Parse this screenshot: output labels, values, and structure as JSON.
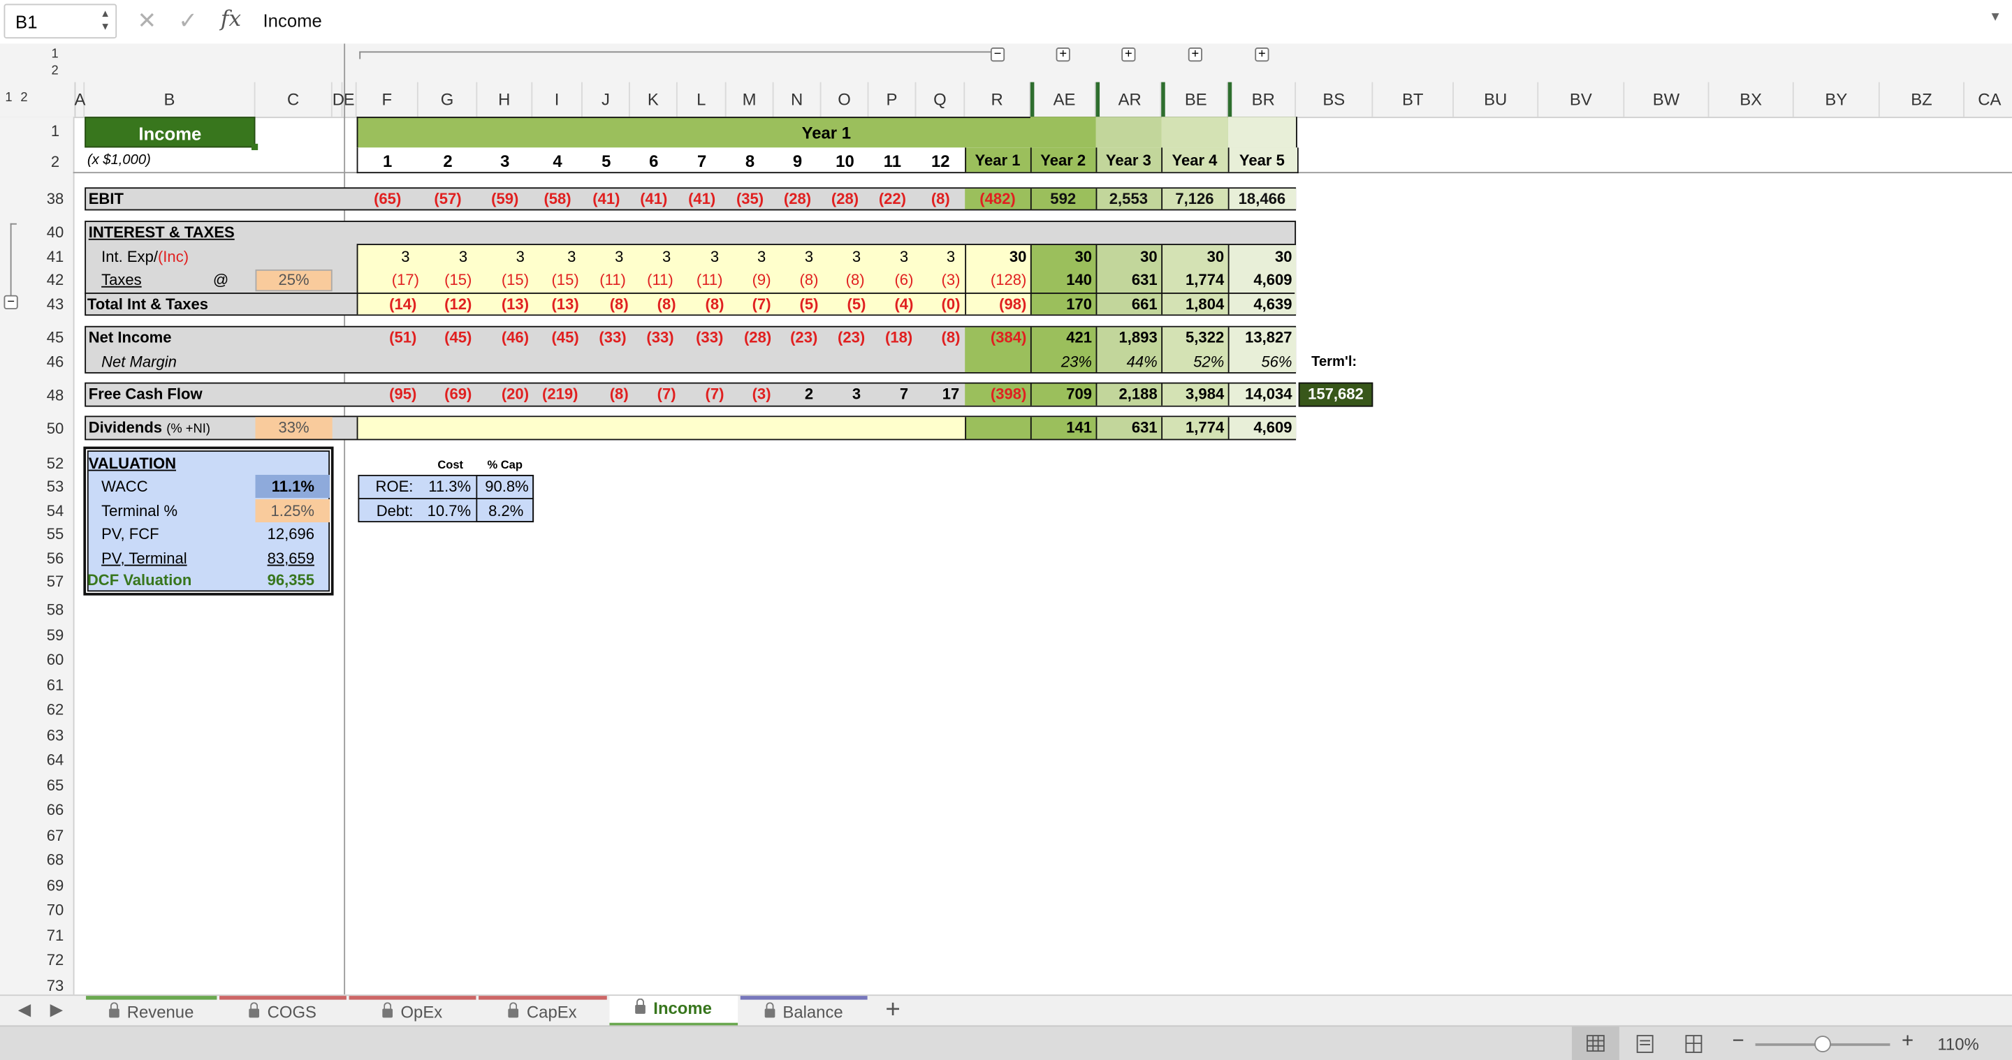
{
  "formula_bar": {
    "name_box": "B1",
    "cancel_icon": "✕",
    "enter_icon": "✓",
    "fx_label": "fx",
    "value": "Income"
  },
  "outline": {
    "row_levels": [
      "1",
      "2"
    ],
    "col_levels": [
      "1",
      "2"
    ]
  },
  "columns": [
    "A",
    "B",
    "C",
    "D",
    "E",
    "F",
    "G",
    "H",
    "I",
    "J",
    "K",
    "L",
    "M",
    "N",
    "O",
    "P",
    "Q",
    "R",
    "AE",
    "AR",
    "BE",
    "BR",
    "BS",
    "BT",
    "BU",
    "BV",
    "BW",
    "BX",
    "BY",
    "BZ",
    "CA"
  ],
  "rows": [
    "1",
    "2",
    "38",
    "40",
    "41",
    "42",
    "43",
    "45",
    "46",
    "48",
    "50",
    "52",
    "53",
    "54",
    "55",
    "56",
    "57",
    "58",
    "59",
    "60",
    "61",
    "62",
    "63",
    "64",
    "65",
    "66",
    "67",
    "68",
    "69",
    "70",
    "71",
    "72",
    "73"
  ],
  "sheet": {
    "title": "Income",
    "subtitle": "(x $1,000)",
    "year_banner": "Year 1",
    "month_headers": [
      "1",
      "2",
      "3",
      "4",
      "5",
      "6",
      "7",
      "8",
      "9",
      "10",
      "11",
      "12"
    ],
    "year_headers": [
      "Year 1",
      "Year 2",
      "Year 3",
      "Year 4",
      "Year 5"
    ],
    "ebit": {
      "label": "EBIT",
      "months": [
        "(65)",
        "(57)",
        "(59)",
        "(58)",
        "(41)",
        "(41)",
        "(41)",
        "(35)",
        "(28)",
        "(28)",
        "(22)",
        "(8)"
      ],
      "years": [
        "(482)",
        "592",
        "2,553",
        "7,126",
        "18,466"
      ]
    },
    "interest_taxes": {
      "label": "INTEREST & TAXES"
    },
    "int_exp": {
      "label": "Int. Exp/",
      "label_red": "(Inc)",
      "months": [
        "3",
        "3",
        "3",
        "3",
        "3",
        "3",
        "3",
        "3",
        "3",
        "3",
        "3",
        "3"
      ],
      "years": [
        "30",
        "30",
        "30",
        "30",
        "30"
      ]
    },
    "taxes": {
      "label": "Taxes",
      "at": "@",
      "rate": "25%",
      "months": [
        "(17)",
        "(15)",
        "(15)",
        "(15)",
        "(11)",
        "(11)",
        "(11)",
        "(9)",
        "(8)",
        "(8)",
        "(6)",
        "(3)"
      ],
      "years": [
        "(128)",
        "140",
        "631",
        "1,774",
        "4,609"
      ]
    },
    "total_int_taxes": {
      "label": "Total Int & Taxes",
      "months": [
        "(14)",
        "(12)",
        "(13)",
        "(13)",
        "(8)",
        "(8)",
        "(8)",
        "(7)",
        "(5)",
        "(5)",
        "(4)",
        "(0)"
      ],
      "years": [
        "(98)",
        "170",
        "661",
        "1,804",
        "4,639"
      ]
    },
    "net_income": {
      "label": "Net Income",
      "months": [
        "(51)",
        "(45)",
        "(46)",
        "(45)",
        "(33)",
        "(33)",
        "(33)",
        "(28)",
        "(23)",
        "(23)",
        "(18)",
        "(8)"
      ],
      "years": [
        "(384)",
        "421",
        "1,893",
        "5,322",
        "13,827"
      ]
    },
    "net_margin": {
      "label": "Net Margin",
      "years": [
        "23%",
        "44%",
        "52%",
        "56%"
      ],
      "terminal_label": "Term'l:"
    },
    "fcf": {
      "label": "Free Cash Flow",
      "months": [
        "(95)",
        "(69)",
        "(20)",
        "(219)",
        "(8)",
        "(7)",
        "(7)",
        "(3)",
        "2",
        "3",
        "7",
        "17"
      ],
      "years": [
        "(398)",
        "709",
        "2,188",
        "3,984",
        "14,034"
      ],
      "terminal": "157,682"
    },
    "dividends": {
      "label": "Dividends",
      "note": "(% +NI)",
      "rate": "33%",
      "years": [
        "141",
        "631",
        "1,774",
        "4,609"
      ]
    },
    "valuation": {
      "title": "VALUATION",
      "wacc_label": "WACC",
      "wacc": "11.1%",
      "terminal_label": "Terminal %",
      "terminal": "1.25%",
      "pv_fcf_label": "PV, FCF",
      "pv_fcf": "12,696",
      "pv_terminal_label": "PV, Terminal",
      "pv_terminal": "83,659",
      "dcf_label": "DCF Valuation",
      "dcf": "96,355"
    },
    "capital": {
      "cost_header": "Cost",
      "pct_header": "% Cap",
      "roe_label": "ROE:",
      "roe_cost": "11.3%",
      "roe_pct": "90.8%",
      "debt_label": "Debt:",
      "debt_cost": "10.7%",
      "debt_pct": "8.2%"
    }
  },
  "tabs": [
    {
      "label": "Revenue",
      "color": "#6aa84f"
    },
    {
      "label": "COGS",
      "color": "#cc6666"
    },
    {
      "label": "OpEx",
      "color": "#cc6666"
    },
    {
      "label": "CapEx",
      "color": "#cc6666"
    },
    {
      "label": "Income",
      "color": "#6aa84f"
    },
    {
      "label": "Balance",
      "color": "#7777bb"
    }
  ],
  "add_sheet": "+",
  "zoom": {
    "level": "110%",
    "fraction": 0.6
  },
  "colors": {
    "dark_green": "#38761d",
    "mid_green": "#9bbf5c",
    "light_green": "#c9d9a2",
    "yellow": "#ffffcc",
    "red": "#e02020",
    "orange": "#f9cb9c",
    "valuation_blue": "#c9daf8",
    "gray": "#d9d9d9"
  }
}
